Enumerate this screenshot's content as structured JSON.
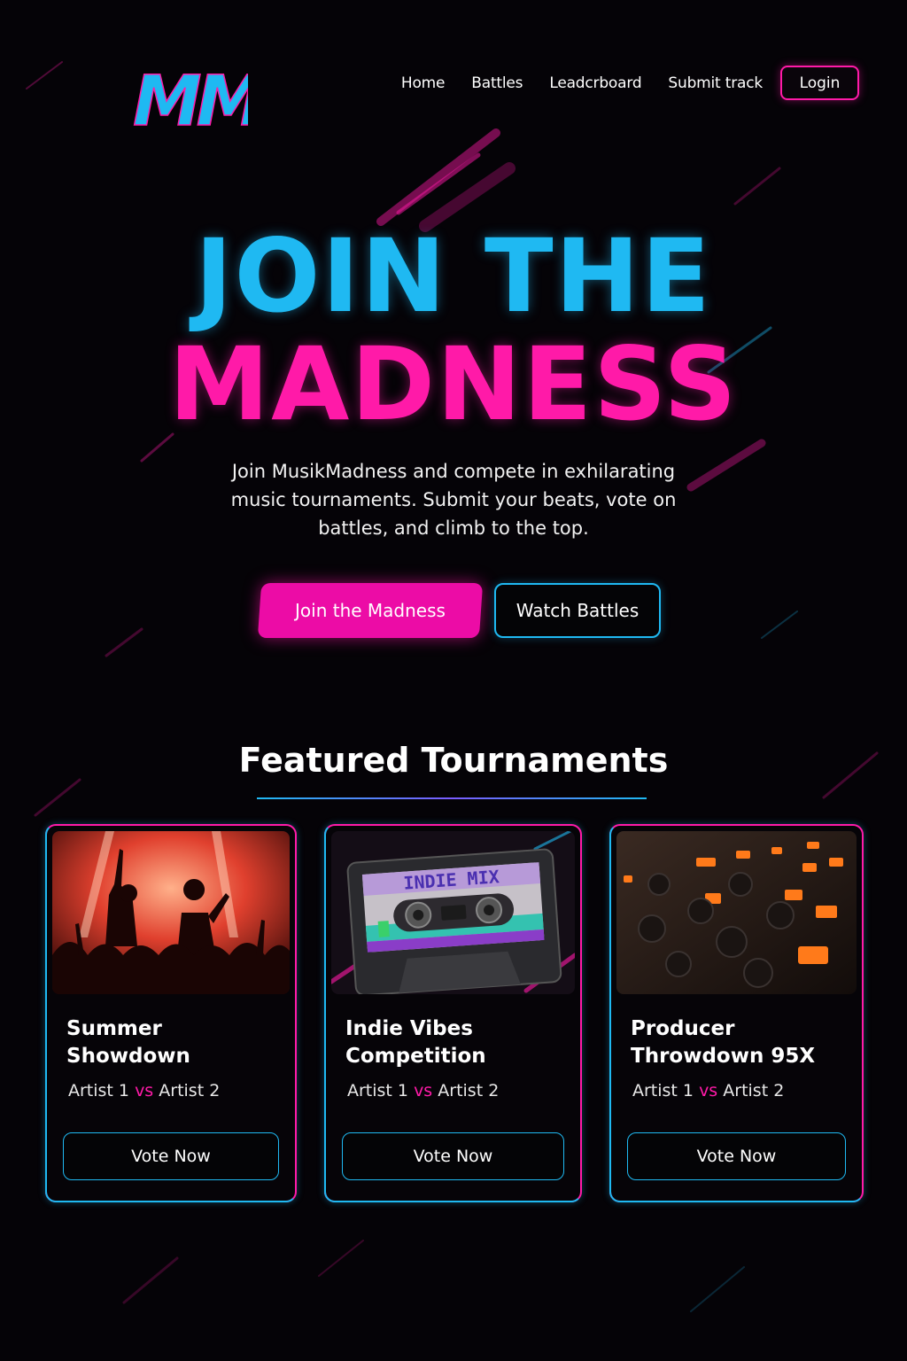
{
  "brand": {
    "logo_text": "MM"
  },
  "nav": {
    "links": [
      "Home",
      "Battles",
      "Leadcrboard",
      "Submit track"
    ],
    "login_label": "Login"
  },
  "hero": {
    "title_line1": "JOIN THE",
    "title_line2": "MADNESS",
    "subtitle": "Join MusikMadness and compete in exhilarating music tournaments. Submit your beats, vote on battles, and climb to the top.",
    "primary_cta": "Join the Madness",
    "secondary_cta": "Watch Battles"
  },
  "featured": {
    "title": "Featured Tournaments",
    "cards": [
      {
        "title": "Summer Showdown",
        "artist_a": "Artist 1",
        "vs": "vs",
        "artist_b": "Artist 2",
        "vote_label": "Vote Now",
        "image": "concert-crowd-image"
      },
      {
        "title": "Indie Vibes Competition",
        "artist_a": "Artist 1",
        "vs": "vs",
        "artist_b": "Artist 2",
        "vote_label": "Vote Now",
        "image": "cassette-tape-image",
        "image_text": "INDIE MIX"
      },
      {
        "title": "Producer Throwdown 95X",
        "artist_a": "Artist 1",
        "vs": "vs",
        "artist_b": "Artist 2",
        "vote_label": "Vote Now",
        "image": "mixing-console-image"
      }
    ]
  },
  "colors": {
    "background": "#050307",
    "cyan": "#1fb9f2",
    "pink": "#ff1aa8"
  }
}
